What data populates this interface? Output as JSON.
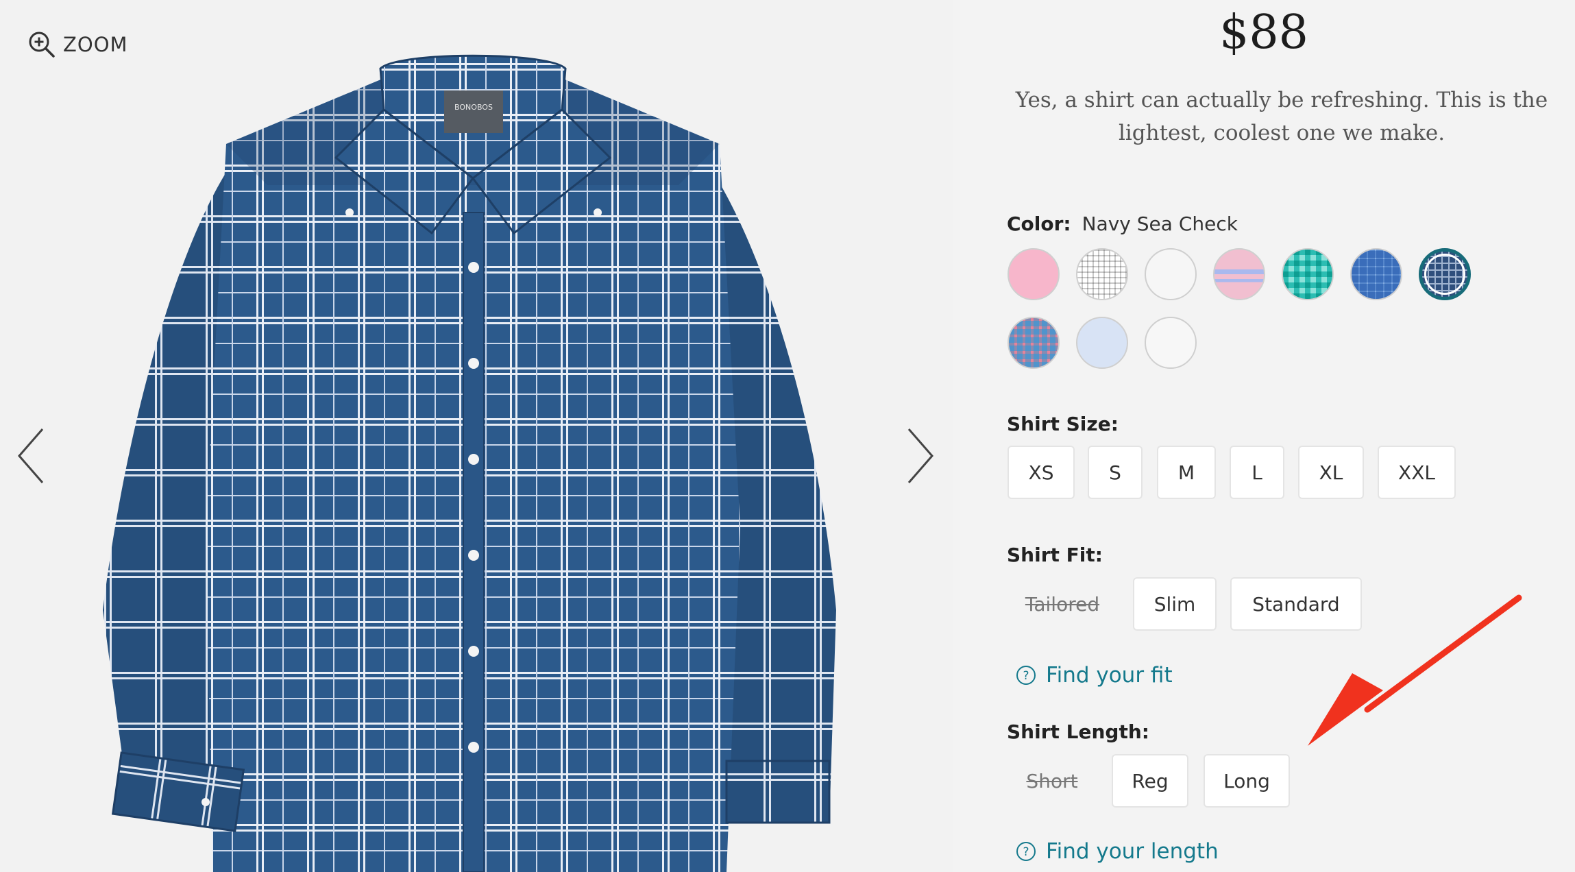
{
  "gallery": {
    "zoom_label": "ZOOM",
    "brand_tag": "BONOBOS"
  },
  "product": {
    "price": "$88",
    "description": "Yes, a shirt can actually be refreshing. This is the lightest, coolest one we make.",
    "color": {
      "label": "Color:",
      "selected": "Navy Sea Check",
      "swatches": [
        "pink",
        "grey-grid",
        "white-dot",
        "pink-stripe",
        "aqua-gingham",
        "blue-check",
        "navy-check",
        "blue-pink-plaid",
        "light-blue",
        "white-print"
      ],
      "colors": {
        "pink": "#f7b6cb",
        "grey-grid": "#dadada",
        "white-dot": "#f6f6f6",
        "pink-stripe": "#eeb8c8",
        "aqua-gingham": "#63d4cc",
        "blue-check": "#8db6e2",
        "navy-check": "#2f4f7c",
        "blue-pink-plaid": "#8fc2e4",
        "light-blue": "#d8e3f5",
        "white-print": "#f7f7f7",
        "selected_ring": "#176b79"
      }
    },
    "size": {
      "label": "Shirt Size:",
      "options": [
        "XS",
        "S",
        "M",
        "L",
        "XL",
        "XXL"
      ]
    },
    "fit": {
      "label": "Shirt Fit:",
      "unavailable": "Tailored",
      "options": [
        "Slim",
        "Standard"
      ],
      "help": "Find your fit"
    },
    "length": {
      "label": "Shirt Length:",
      "unavailable": "Short",
      "options": [
        "Reg",
        "Long"
      ],
      "help": "Find your length"
    }
  },
  "theme": {
    "accent": "#14798c",
    "annotation_arrow": "#f0321e",
    "shirt_navy": "#2c5a8c"
  }
}
